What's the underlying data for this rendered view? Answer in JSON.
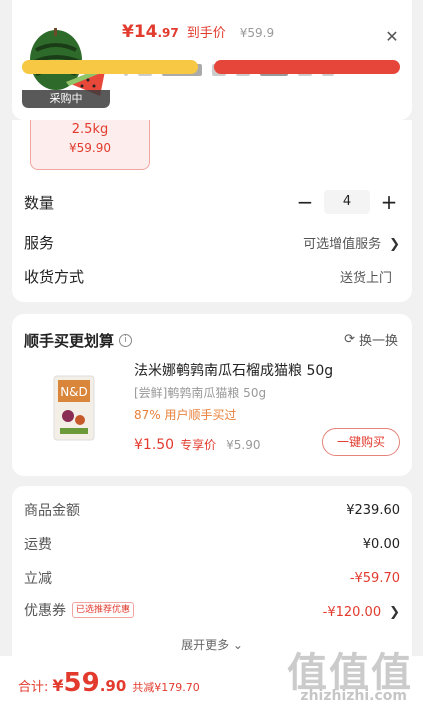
{
  "header": {
    "badge": "采购中",
    "price_int": "¥14",
    "price_dec": ".97",
    "price_tag": "到手价",
    "price_orig": "¥59.9"
  },
  "sku": {
    "weight": "2.5kg",
    "price": "¥59.90"
  },
  "options": {
    "qty_label": "数量",
    "qty_value": "4",
    "minus": "−",
    "plus": "+",
    "service_label": "服务",
    "service_value": "可选增值服务",
    "delivery_label": "收货方式",
    "delivery_value": "送货上门"
  },
  "addon": {
    "title": "顺手买更划算",
    "swap": "换一换",
    "name": "法米娜鹌鹑南瓜石榴成猫粮 50g",
    "sub": "[尝鲜]鹌鹑南瓜猫粮 50g",
    "pct": "87% 用户顺手买过",
    "price": "¥1.50",
    "price_tag": "专享价",
    "price_orig": "¥5.90",
    "button": "一键购买"
  },
  "summary": {
    "goods_label": "商品金额",
    "goods_value": "¥239.60",
    "shipping_label": "运费",
    "shipping_value": "¥0.00",
    "discount_label": "立减",
    "discount_value": "-¥59.70",
    "coupon_label": "优惠券",
    "coupon_badge": "已选推荐优惠",
    "coupon_value": "-¥120.00",
    "expand": "展开更多 ⌄"
  },
  "footer": {
    "total_label": "合计:",
    "total_cur": "¥",
    "total_int": "59",
    "total_dec": ".90",
    "total_save": "共减¥179.70"
  },
  "watermark": {
    "main": "值值值",
    "sub": "zhizhizhi.com"
  },
  "colors": {
    "accent_red": "#e23b2e",
    "orange": "#e8803a",
    "yellow_button": "#f6c844"
  }
}
